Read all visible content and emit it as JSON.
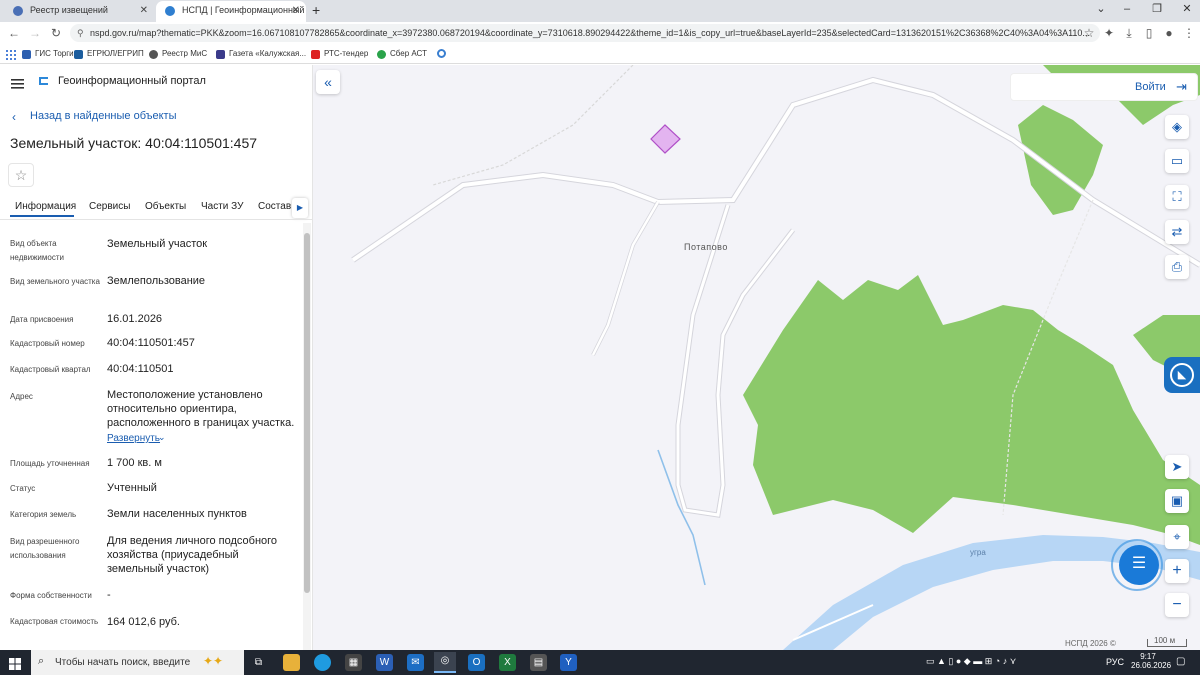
{
  "browser": {
    "tabs": [
      {
        "title": "Реестр извещений",
        "active": false
      },
      {
        "title": "НСПД | Геоинформационный п",
        "active": true
      }
    ],
    "new_tab": "+",
    "url": "nspd.gov.ru/map?thematic=PKK&zoom=16.067108107782865&coordinate_x=3972380.068720194&coordinate_y=7310618.890294422&theme_id=1&is_copy_url=true&baseLayerId=235&selectedCard=1313620151%2C36368%2C40%3A04%3A110...",
    "bookmarks": [
      "ГИС Торги",
      "ЕГРЮЛ/ЕГРИП",
      "Реестр МиС",
      "Газета «Калужская...",
      "РТС-тендер",
      "Сбер АСТ"
    ]
  },
  "portal": {
    "title": "Геоинформационный портал",
    "back_label": "Назад в найденные объекты",
    "object_title": "Земельный участок: 40:04:110501:457",
    "tabs": [
      "Информация",
      "Сервисы",
      "Объекты",
      "Части ЗУ",
      "Состав"
    ],
    "fields": [
      {
        "label": "Вид объекта недвижимости",
        "value": "Земельный участок"
      },
      {
        "label": "Вид земельного участка",
        "value": "Землепользование"
      },
      {
        "label": "Дата присвоения",
        "value": "16.01.2026"
      },
      {
        "label": "Кадастровый номер",
        "value": "40:04:110501:457"
      },
      {
        "label": "Кадастровый квартал",
        "value": "40:04:110501"
      },
      {
        "label": "Адрес",
        "value": "Местоположение установлено относительно ориентира, расположенного в границах участка."
      },
      {
        "label": "Площадь уточненная",
        "value": "1 700 кв. м"
      },
      {
        "label": "Статус",
        "value": "Учтенный"
      },
      {
        "label": "Категория земель",
        "value": "Земли населенных пунктов"
      },
      {
        "label": "Вид разрешенного использования",
        "value": "Для ведения личного подсобного хозяйства (приусадебный земельный участок)"
      },
      {
        "label": "Форма собственности",
        "value": "-"
      },
      {
        "label": "Кадастровая стоимость",
        "value": "164 012,6 руб."
      }
    ],
    "expand_label": "Развернуть"
  },
  "map": {
    "login_label": "Войти",
    "village_label": "Потапово",
    "river_label": "угра",
    "attribution": "НСПД 2026 ©",
    "scale_label": "100 м",
    "colors": {
      "forest": "#8cc96a",
      "river": "#b7d6f5",
      "parcel": "#e3b4f0",
      "accent": "#1a5db0"
    }
  },
  "taskbar": {
    "search_placeholder": "Чтобы начать поиск, введите",
    "lang": "РУС",
    "time": "9:17",
    "date": "26.06.2026"
  }
}
